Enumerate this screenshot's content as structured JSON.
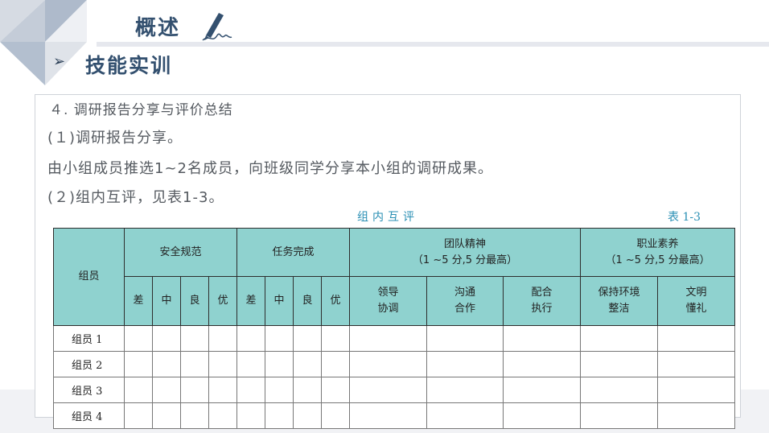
{
  "header": {
    "title": "概述",
    "subtitle_arrow": "➢",
    "subtitle": "技能实训"
  },
  "content": {
    "line1": "４. 调研报告分享与评价总结",
    "line2": "(１)调研报告分享。",
    "line3": "由小组成员推选1~2名成员，向班级同学分享本小组的调研成果。",
    "line4": "(２)组内互评，见表1-3。"
  },
  "table": {
    "caption": "组内互评",
    "number": "表 1-3",
    "member_header": "组员",
    "groups": [
      {
        "label": "安全规范",
        "sub": ""
      },
      {
        "label": "任务完成",
        "sub": ""
      },
      {
        "label": "团队精神",
        "sub": "（1 ~5 分,5 分最高）"
      },
      {
        "label": "职业素养",
        "sub": "（1 ~5 分,5 分最高）"
      }
    ],
    "grades": [
      "差",
      "中",
      "良",
      "优"
    ],
    "team_cols": [
      [
        "领导",
        "协调"
      ],
      [
        "沟通",
        "合作"
      ],
      [
        "配合",
        "执行"
      ]
    ],
    "prof_cols": [
      [
        "保持环境",
        "整洁"
      ],
      [
        "文明",
        "懂礼"
      ]
    ],
    "members": [
      "组员 1",
      "组员 2",
      "组员 3",
      "组员 4"
    ]
  },
  "colors": {
    "title": "#33506f",
    "table_header": "#8fd2cf",
    "caption": "#2a8fb4"
  },
  "icons": {
    "pen": "pen-writing-icon",
    "arrow": "arrow-bullet-icon"
  }
}
